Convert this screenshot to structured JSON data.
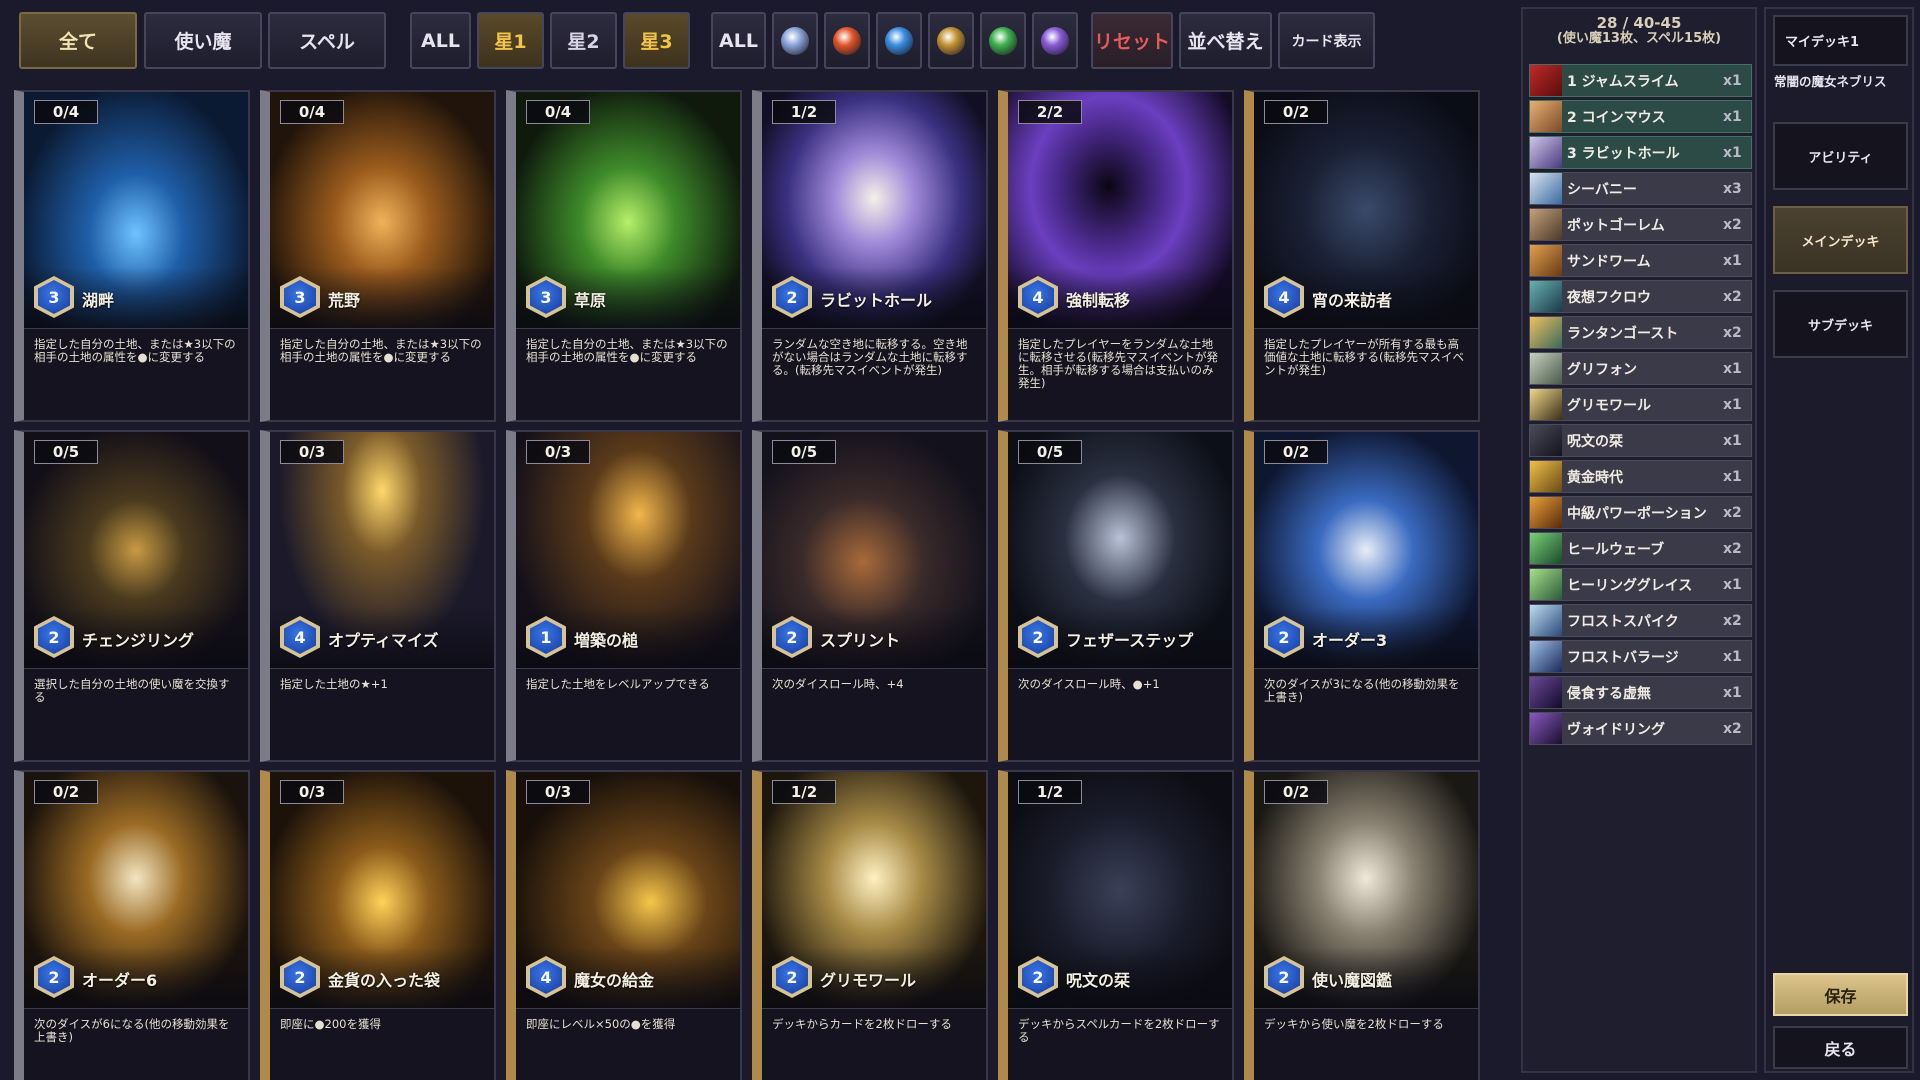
{
  "filters": {
    "type": [
      "全て",
      "使い魔",
      "スペル"
    ],
    "star": [
      "ALL",
      "星1",
      "星2",
      "星3"
    ],
    "attr_all": "ALL",
    "attributes": [
      {
        "icon": "neutral-attribute-icon",
        "color": "#8aa3d8"
      },
      {
        "icon": "fire-attribute-icon",
        "color": "#e2562b"
      },
      {
        "icon": "water-attribute-icon",
        "color": "#3c8de0"
      },
      {
        "icon": "earth-attribute-icon",
        "color": "#c39333"
      },
      {
        "icon": "wind-attribute-icon",
        "color": "#3fb04d"
      },
      {
        "icon": "dark-attribute-icon",
        "color": "#8a5bd6"
      }
    ],
    "reset": "リセット",
    "sort": "並べ替え",
    "card_view": "カード表示"
  },
  "cards": [
    {
      "count": "0/4",
      "cost": "3",
      "name": "湖畔",
      "desc": "指定した自分の土地、または★3以下の相手の土地の属性を●に変更する",
      "art": "radial-gradient(ellipse at 50% 60%, #6fc3ff 0%, #1f5ea8 30%, #0b1a33 75%)"
    },
    {
      "count": "0/4",
      "cost": "3",
      "name": "荒野",
      "desc": "指定した自分の土地、または★3以下の相手の土地の属性を●に変更する",
      "art": "radial-gradient(ellipse at 50% 55%, #f0b35a 0%, #9a5b1d 30%, #21140a 75%)"
    },
    {
      "count": "0/4",
      "cost": "3",
      "name": "草原",
      "desc": "指定した自分の土地、または★3以下の相手の土地の属性を●に変更する",
      "art": "radial-gradient(ellipse at 50% 55%, #b6ef6a 0%, #3e8a2a 30%, #0f1a0d 75%)"
    },
    {
      "count": "1/2",
      "cost": "2",
      "name": "ラビットホール",
      "desc": "ランダムな空き地に転移する。空き地がない場合はランダムな土地に転移する。(転移先マスイベントが発生)",
      "art": "radial-gradient(ellipse at 50% 45%, #f5f1e8 0%, #9f8ad8 25%, #3a3080 55%, #120f25 80%)"
    },
    {
      "count": "2/2",
      "cost": "4",
      "name": "強制転移",
      "desc": "指定したプレイヤーをランダムな土地に転移させる(転移先マスイベントが発生。相手が転移する場合は支払いのみ発生)",
      "art": "radial-gradient(ellipse at 45% 40%, #0a0614 0%, #4a2a8c 30%, #6b3fc0 45%, #140b27 80%)"
    },
    {
      "count": "0/2",
      "cost": "4",
      "name": "宵の来訪者",
      "desc": "指定したプレイヤーが所有する最も高価値な土地に転移する(転移先マスイベントが発生)",
      "art": "radial-gradient(ellipse at 50% 50%, #3a4a6a 0%, #1a2034 40%, #0b0d16 80%)"
    },
    {
      "count": "0/5",
      "cost": "2",
      "name": "チェンジリング",
      "desc": "選択した自分の土地の使い魔を交換する",
      "art": "radial-gradient(ellipse at 50% 50%, #c89a44 0%, #4a3a1e 30%, #120f18 75%)"
    },
    {
      "count": "0/3",
      "cost": "4",
      "name": "オプティマイズ",
      "desc": "指定した土地の★+1",
      "art": "radial-gradient(ellipse at 50% 25%, #ffd86b 0%, #7a5a2a 25%, #1c1a2a 65%)"
    },
    {
      "count": "0/3",
      "cost": "1",
      "name": "増築の槌",
      "desc": "指定した土地をレベルアップできる",
      "art": "radial-gradient(ellipse at 55% 35%, #f2b64b 0%, #5a3a1a 30%, #14101a 75%)"
    },
    {
      "count": "0/5",
      "cost": "2",
      "name": "スプリント",
      "desc": "次のダイスロール時、+4",
      "art": "radial-gradient(ellipse at 45% 55%, #a86a3a 0%, #3a2a2a 35%, #12111c 75%)"
    },
    {
      "count": "0/5",
      "cost": "2",
      "name": "フェザーステップ",
      "desc": "次のダイスロール時、●+1",
      "art": "radial-gradient(ellipse at 50% 45%, #b9c2d8 0%, #2a3040 35%, #0d0f18 75%)"
    },
    {
      "count": "0/2",
      "cost": "2",
      "name": "オーダー3",
      "desc": "次のダイスが3になる(他の移動効果を上書き)",
      "art": "radial-gradient(ellipse at 50% 50%, #e8eef8 0%, #3a6ac0 30%, #0e1630 75%)"
    },
    {
      "count": "0/2",
      "cost": "2",
      "name": "オーダー6",
      "desc": "次のダイスが6になる(他の移動効果を上書き)",
      "art": "radial-gradient(ellipse at 50% 45%, #f3e6c2 0%, #9a6a24 30%, #1a120c 75%)"
    },
    {
      "count": "0/3",
      "cost": "2",
      "name": "金貨の入った袋",
      "desc": "即座に●200を獲得",
      "art": "radial-gradient(ellipse at 50% 55%, #ffd25a 0%, #8a5a1a 30%, #1c120a 75%)"
    },
    {
      "count": "0/3",
      "cost": "4",
      "name": "魔女の給金",
      "desc": "即座にレベル×50の●を獲得",
      "art": "radial-gradient(ellipse at 60% 55%, #f5c64a 0%, #6a4418 30%, #160f0a 75%)"
    },
    {
      "count": "1/2",
      "cost": "2",
      "name": "グリモワール",
      "desc": "デッキからカードを2枚ドローする",
      "art": "radial-gradient(ellipse at 50% 45%, #fff1c2 0%, #a78a46 30%, #1c160d 75%)"
    },
    {
      "count": "1/2",
      "cost": "2",
      "name": "呪文の栞",
      "desc": "デッキからスペルカードを2枚ドローする",
      "art": "radial-gradient(ellipse at 50% 50%, #3a4058 0%, #1a1c2a 45%, #0d0d14 80%)"
    },
    {
      "count": "0/2",
      "cost": "2",
      "name": "使い魔図鑑",
      "desc": "デッキから使い魔を2枚ドローする",
      "art": "radial-gradient(ellipse at 50% 45%, #f0e8d8 0%, #8a8272 30%, #1a1814 75%)"
    }
  ],
  "deck": {
    "count_line1": "28 / 40-45",
    "count_line2": "(使い魔13枚、スペル15枚)",
    "rows": [
      {
        "name": "1 ジャムスライム",
        "qty": "x1",
        "thumb": "linear-gradient(135deg,#c02a2a,#5a0c0c)"
      },
      {
        "name": "2 コインマウス",
        "qty": "x1",
        "thumb": "linear-gradient(135deg,#e8b070,#7a4a2a)"
      },
      {
        "name": "3 ラビットホール",
        "qty": "x1",
        "thumb": "linear-gradient(135deg,#cfc6e8,#4a3a80)"
      },
      {
        "name": "シーバニー",
        "qty": "x3",
        "thumb": "linear-gradient(135deg,#d8e4f0,#3a6aa0)"
      },
      {
        "name": "ポットゴーレム",
        "qty": "x2",
        "thumb": "linear-gradient(135deg,#c6a07a,#4a3a2a)"
      },
      {
        "name": "サンドワーム",
        "qty": "x1",
        "thumb": "linear-gradient(135deg,#e0a050,#6a3a14)"
      },
      {
        "name": "夜想フクロウ",
        "qty": "x2",
        "thumb": "linear-gradient(135deg,#6ab0b0,#1a3a4a)"
      },
      {
        "name": "ランタンゴースト",
        "qty": "x2",
        "thumb": "linear-gradient(135deg,#f0c060,#3a6a5a)"
      },
      {
        "name": "グリフォン",
        "qty": "x1",
        "thumb": "linear-gradient(135deg,#c8d0c0,#4a5a4a)"
      },
      {
        "name": "グリモワール",
        "qty": "x1",
        "thumb": "linear-gradient(135deg,#f0d88a,#3a2e18)"
      },
      {
        "name": "呪文の栞",
        "qty": "x1",
        "thumb": "linear-gradient(135deg,#4a4a5a,#14141e)"
      },
      {
        "name": "黄金時代",
        "qty": "x1",
        "thumb": "linear-gradient(135deg,#f0c04a,#6a4a14)"
      },
      {
        "name": "中級パワーポーション",
        "qty": "x2",
        "thumb": "linear-gradient(135deg,#e8a03a,#5a2a0a)"
      },
      {
        "name": "ヒールウェーブ",
        "qty": "x2",
        "thumb": "linear-gradient(135deg,#7ad07a,#1a4a2a)"
      },
      {
        "name": "ヒーリンググレイス",
        "qty": "x1",
        "thumb": "linear-gradient(135deg,#a8e08a,#2a5a3a)"
      },
      {
        "name": "フロストスパイク",
        "qty": "x2",
        "thumb": "linear-gradient(135deg,#c0dcf0,#2a4a7a)"
      },
      {
        "name": "フロストバラージ",
        "qty": "x1",
        "thumb": "linear-gradient(135deg,#a0c0e8,#1a2a5a)"
      },
      {
        "name": "侵食する虚無",
        "qty": "x1",
        "thumb": "linear-gradient(135deg,#6a4a9a,#140a2a)"
      },
      {
        "name": "ヴォイドリング",
        "qty": "x2",
        "thumb": "linear-gradient(135deg,#8a5ac0,#1a0e30)"
      }
    ]
  },
  "panel": {
    "deck_select": "マイデッキ1",
    "deck_label": "常闇の魔女ネブリス",
    "ability": "アビリティ",
    "main_deck": "メインデッキ",
    "sub_deck": "サブデッキ",
    "save": "保存",
    "back": "戻る"
  }
}
